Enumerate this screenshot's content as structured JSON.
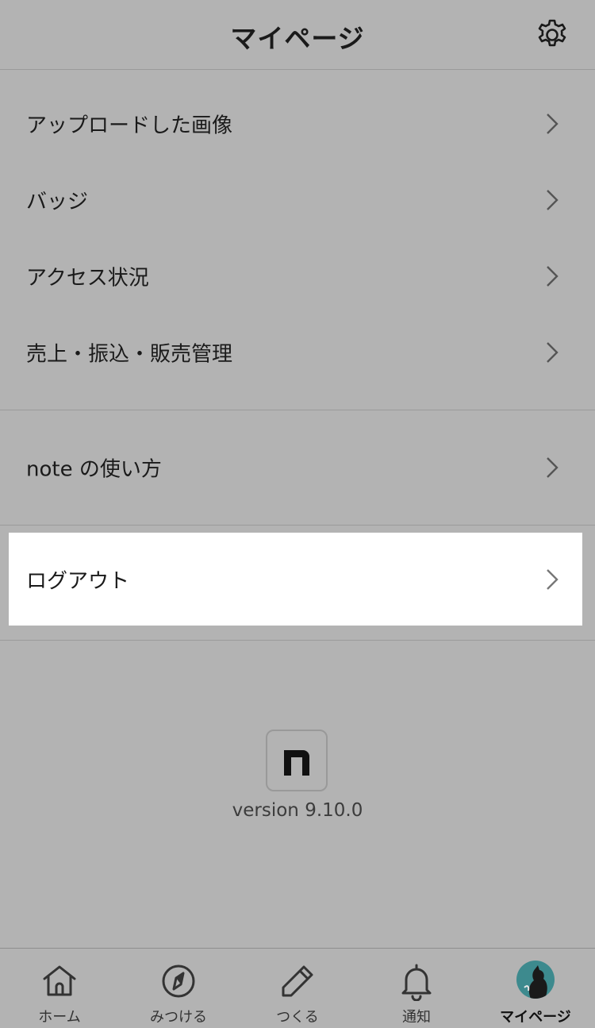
{
  "header": {
    "title": "マイページ",
    "settings_icon": "gear-icon"
  },
  "menu_group_1": [
    {
      "label": "アップロードした画像"
    },
    {
      "label": "バッジ"
    },
    {
      "label": "アクセス状況"
    },
    {
      "label": "売上・振込・販売管理"
    }
  ],
  "menu_group_2": [
    {
      "label": "note の使い方"
    }
  ],
  "logout": {
    "label": "ログアウト"
  },
  "footer": {
    "logo_letter": "n",
    "version": "version 9.10.0"
  },
  "tabbar": {
    "tabs": [
      {
        "label": "ホーム",
        "icon": "home-icon"
      },
      {
        "label": "みつける",
        "icon": "compass-icon"
      },
      {
        "label": "つくる",
        "icon": "pencil-icon"
      },
      {
        "label": "通知",
        "icon": "bell-icon"
      },
      {
        "label": "マイページ",
        "icon": "avatar",
        "active": true
      }
    ]
  },
  "colors": {
    "background": "#b3b3b3",
    "highlight": "#ffffff",
    "text": "#1a1a1a"
  }
}
